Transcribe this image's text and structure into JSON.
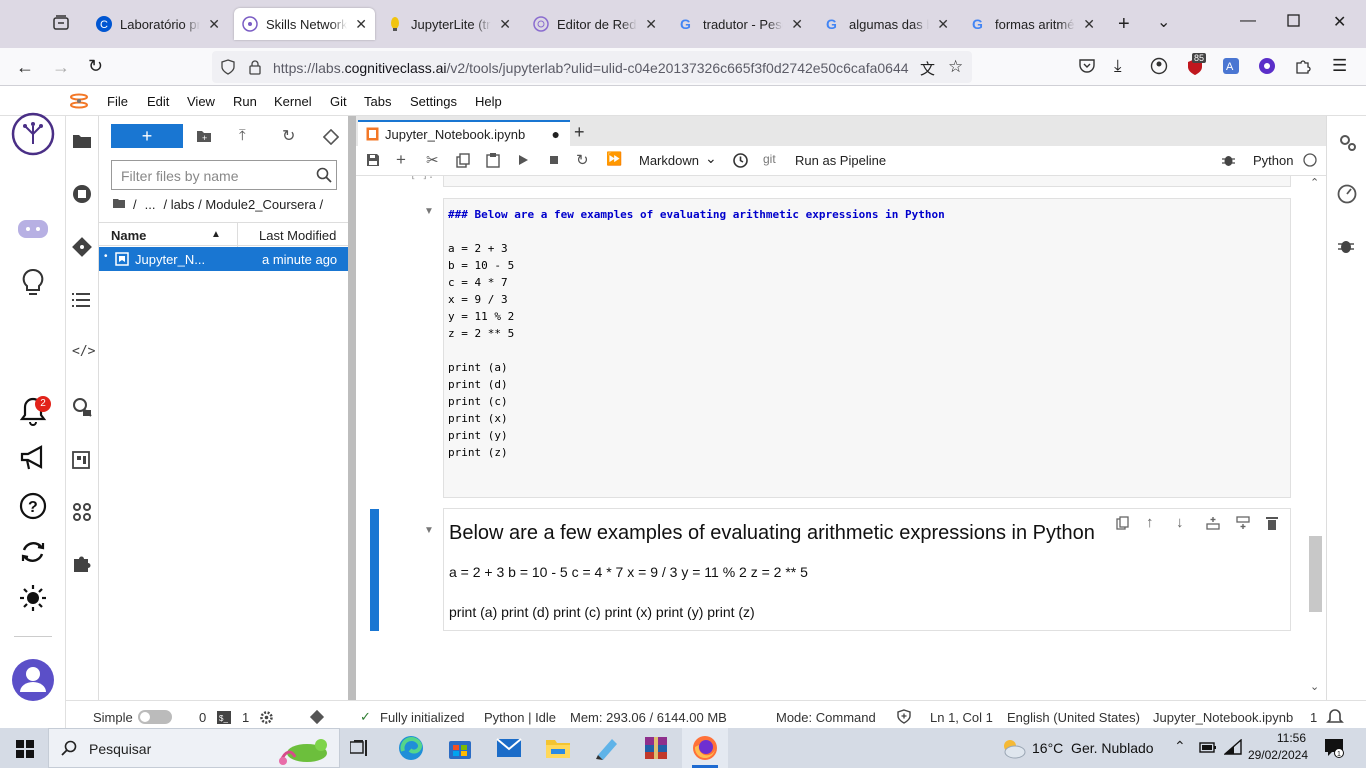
{
  "browser": {
    "tabs": [
      {
        "title": "Laboratório práti",
        "icon": "coursera-icon"
      },
      {
        "title": "Skills Network La",
        "icon": "skills-network-icon",
        "active": true
      },
      {
        "title": "JupyterLite (trata",
        "icon": "jupyterlite-icon"
      },
      {
        "title": "Editor de Rede d",
        "icon": "network-editor-icon"
      },
      {
        "title": "tradutor - Pesqui",
        "icon": "google-icon"
      },
      {
        "title": "algumas das bibl",
        "icon": "google-icon"
      },
      {
        "title": "formas aritmétic",
        "icon": "google-icon"
      }
    ],
    "url_prefix": "https://labs.",
    "url_domain": "cognitiveclass.ai",
    "url_suffix": "/v2/tools/jupyterlab?ulid=ulid-c04e20137326c665f3f0d2742e50c6cafa0644",
    "notification_badge": "85"
  },
  "jupyter": {
    "menu": [
      "File",
      "Edit",
      "View",
      "Run",
      "Kernel",
      "Git",
      "Tabs",
      "Settings",
      "Help"
    ],
    "filebrowser": {
      "filter_placeholder": "Filter files by name",
      "breadcrumb_root": "/",
      "breadcrumb_ellipsis": "...",
      "breadcrumb_path": "/ labs / Module2_Coursera /",
      "col_name": "Name",
      "col_modified": "Last Modified",
      "files": [
        {
          "name": "Jupyter_N...",
          "modified": "a minute ago"
        }
      ]
    },
    "notification_count": "2",
    "doc_tab": {
      "title": "Jupyter_Notebook.ipynb"
    },
    "toolbar": {
      "cell_type": "Markdown",
      "git_label": "git",
      "pipeline_label": "Run as Pipeline",
      "kernel_name": "Python"
    },
    "cells": {
      "prev_prompt": "[ ]:",
      "raw_source": "### Below are a few examples of evaluating arithmetic expressions in Python\n\na = 2 + 3\nb = 10 - 5\nc = 4 * 7\nx = 9 / 3\ny = 11 % 2\nz = 2 ** 5\n\nprint (a)\nprint (d)\nprint (c)\nprint (x)\nprint (y)\nprint (z)",
      "rendered_heading": "Below are a few examples of evaluating arithmetic expressions in Python",
      "rendered_para1": "a = 2 + 3 b = 10 - 5 c = 4 * 7 x = 9 / 3 y = 11 % 2 z = 2 ** 5",
      "rendered_para2": "print (a) print (d) print (c) print (x) print (y) print (z)"
    },
    "status": {
      "mode_label": "Simple",
      "terminals": "0",
      "kernels": "1",
      "git_status": "Fully initialized",
      "kernel_status": "Python | Idle",
      "memory": "Mem: 293.06 / 6144.00 MB",
      "mode": "Mode: Command",
      "cursor": "Ln 1, Col 1",
      "language": "English (United States)",
      "filename": "Jupyter_Notebook.ipynb",
      "notif": "1"
    }
  },
  "taskbar": {
    "search_placeholder": "Pesquisar",
    "weather": "16°C  Ger. Nublado",
    "time": "11:56",
    "date": "29/02/2024"
  },
  "colors": {
    "accent": "#1976d2",
    "selected_row": "#1976d2"
  }
}
